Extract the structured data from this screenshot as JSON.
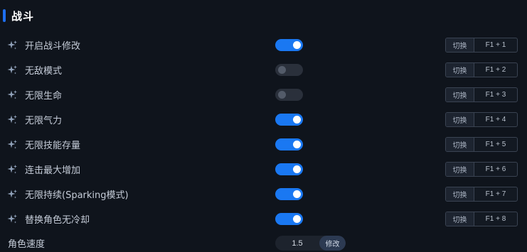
{
  "section": {
    "title": "战斗",
    "accent_color": "#1e6ff0"
  },
  "rows": [
    {
      "label": "开启战斗修改",
      "enabled": true,
      "switch_label": "切换",
      "hotkey": "F1 + 1"
    },
    {
      "label": "无敌模式",
      "enabled": false,
      "switch_label": "切换",
      "hotkey": "F1 + 2"
    },
    {
      "label": "无限生命",
      "enabled": false,
      "switch_label": "切换",
      "hotkey": "F1 + 3"
    },
    {
      "label": "无限气力",
      "enabled": true,
      "switch_label": "切换",
      "hotkey": "F1 + 4"
    },
    {
      "label": "无限技能存量",
      "enabled": true,
      "switch_label": "切换",
      "hotkey": "F1 + 5"
    },
    {
      "label": "连击最大增加",
      "enabled": true,
      "switch_label": "切换",
      "hotkey": "F1 + 6"
    },
    {
      "label": "无限持续(Sparking模式)",
      "enabled": true,
      "switch_label": "切换",
      "hotkey": "F1 + 7"
    },
    {
      "label": "替换角色无冷却",
      "enabled": true,
      "switch_label": "切换",
      "hotkey": "F1 + 8"
    }
  ],
  "speed": {
    "label": "角色速度",
    "value": "1.5",
    "button_label": "修改"
  },
  "icons": {
    "row_icon": "sparkle-icon"
  },
  "colors": {
    "toggle_on": "#1a78f2",
    "toggle_off": "#2a303b",
    "background": "#0f141c"
  }
}
